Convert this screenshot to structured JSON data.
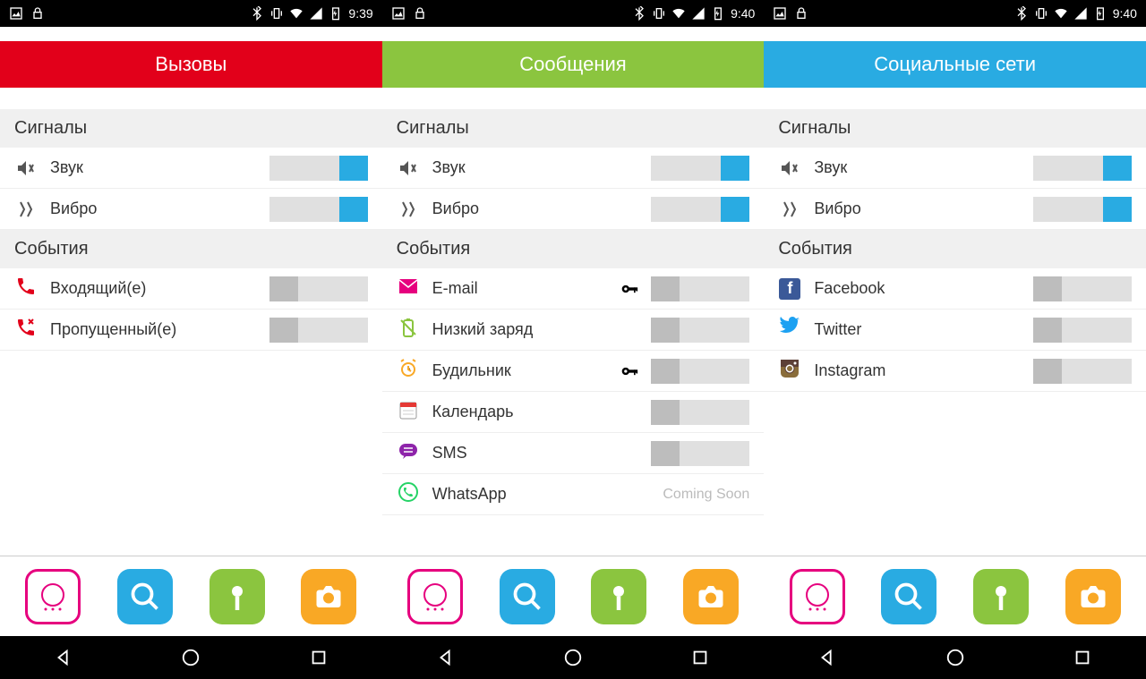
{
  "panels": [
    {
      "time": "9:39",
      "tabColor": "tab-red",
      "tabLabel": "Вызовы",
      "signalsHeader": "Сигналы",
      "eventsHeader": "События",
      "soundLabel": "Звук",
      "vibroLabel": "Вибро",
      "events": [
        {
          "icon": "phone-in",
          "label": "Входящий(е)",
          "toggle": "off-left",
          "color": "#e2001a"
        },
        {
          "icon": "phone-missed",
          "label": "Пропущенный(е)",
          "toggle": "off-left",
          "color": "#e2001a"
        }
      ]
    },
    {
      "time": "9:40",
      "tabColor": "tab-green",
      "tabLabel": "Сообщения",
      "signalsHeader": "Сигналы",
      "eventsHeader": "События",
      "soundLabel": "Звук",
      "vibroLabel": "Вибро",
      "events": [
        {
          "icon": "email",
          "label": "E-mail",
          "toggle": "off-left",
          "key": true,
          "color": "#e6007e"
        },
        {
          "icon": "battery-low",
          "label": "Низкий заряд",
          "toggle": "off-left",
          "color": "#8bc53f"
        },
        {
          "icon": "alarm",
          "label": "Будильник",
          "toggle": "off-left",
          "key": true,
          "color": "#f9a825"
        },
        {
          "icon": "calendar",
          "label": "Календарь",
          "toggle": "off-left",
          "color": "#e53935"
        },
        {
          "icon": "sms",
          "label": "SMS",
          "toggle": "off-left",
          "color": "#8e24aa"
        },
        {
          "icon": "whatsapp",
          "label": "WhatsApp",
          "comingSoon": "Coming Soon",
          "color": "#25d366"
        }
      ]
    },
    {
      "time": "9:40",
      "tabColor": "tab-blue",
      "tabLabel": "Социальные сети",
      "signalsHeader": "Сигналы",
      "eventsHeader": "События",
      "soundLabel": "Звук",
      "vibroLabel": "Вибро",
      "events": [
        {
          "icon": "facebook",
          "label": "Facebook",
          "toggle": "off-left"
        },
        {
          "icon": "twitter",
          "label": "Twitter",
          "toggle": "off-left",
          "color": "#1da1f2"
        },
        {
          "icon": "instagram",
          "label": "Instagram",
          "toggle": "off-left"
        }
      ]
    }
  ]
}
